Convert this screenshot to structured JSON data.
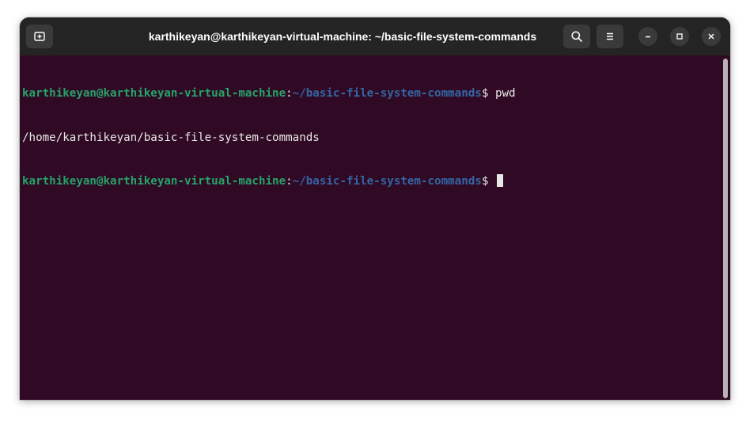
{
  "window": {
    "title": "karthikeyan@karthikeyan-virtual-machine: ~/basic-file-system-commands"
  },
  "icons": {
    "new_tab": "new-tab-icon",
    "search": "search-icon",
    "menu": "hamburger-menu-icon",
    "minimize": "minimize-icon",
    "maximize": "maximize-icon",
    "close": "close-icon"
  },
  "terminal": {
    "lines": [
      {
        "user": "karthikeyan@karthikeyan-virtual-machine",
        "colon": ":",
        "path": "~/basic-file-system-commands",
        "prompt": "$ ",
        "command": "pwd"
      },
      {
        "output": "/home/karthikeyan/basic-file-system-commands"
      },
      {
        "user": "karthikeyan@karthikeyan-virtual-machine",
        "colon": ":",
        "path": "~/basic-file-system-commands",
        "prompt": "$ ",
        "command": ""
      }
    ]
  },
  "colors": {
    "terminal_bg": "#300a24",
    "prompt_user": "#26a269",
    "prompt_path": "#3465a4",
    "titlebar_bg": "#242424"
  }
}
